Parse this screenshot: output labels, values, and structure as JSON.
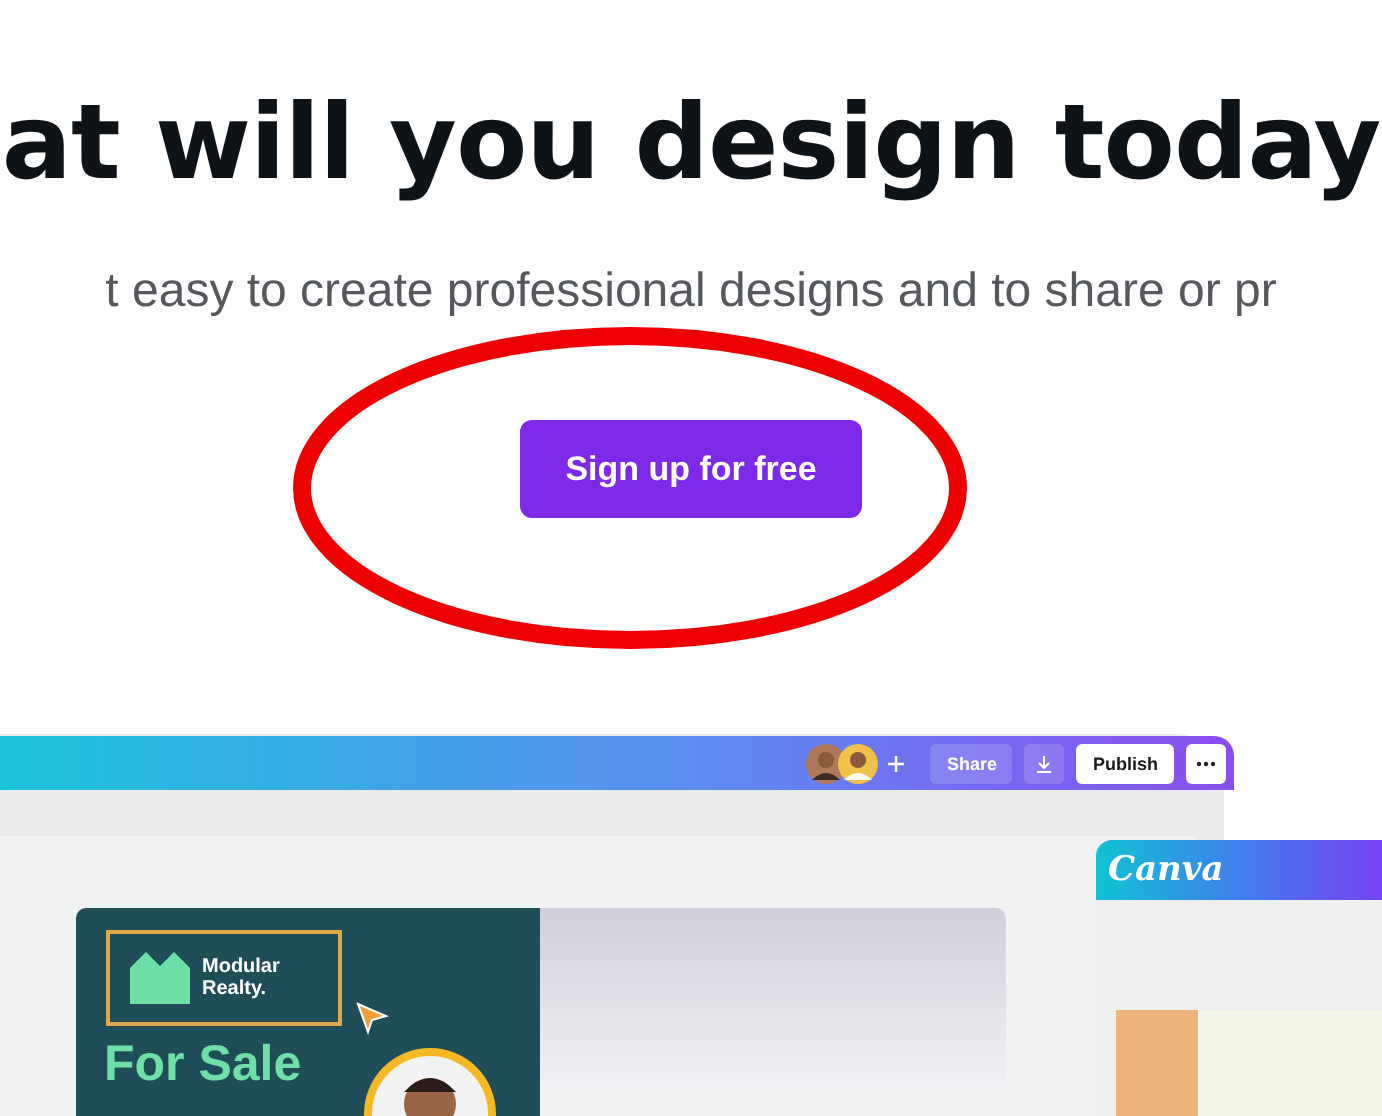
{
  "headline": "at will you design today",
  "subtitle": "t easy to create professional designs and to share or pr",
  "cta": {
    "label": "Sign up for free"
  },
  "editor": {
    "toolbar": {
      "share": "Share",
      "publish": "Publish"
    },
    "design": {
      "brand": "Modular Realty.",
      "title": "For Sale"
    }
  },
  "side_panel": {
    "logo": "Canva"
  }
}
